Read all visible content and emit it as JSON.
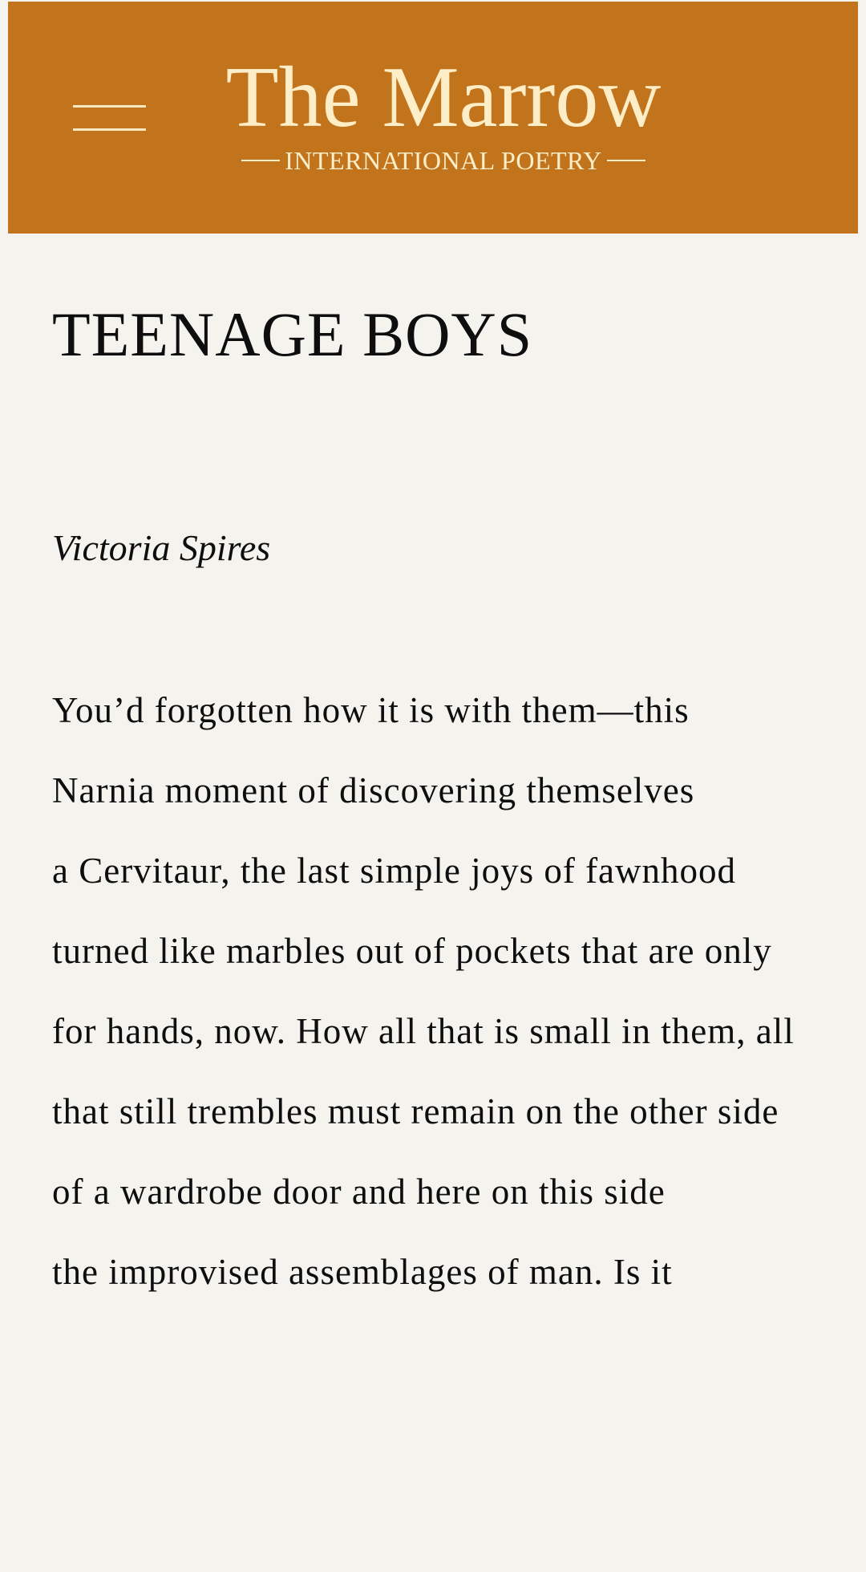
{
  "header": {
    "menu_icon": "hamburger-menu-icon",
    "site_title": "The Marrow",
    "site_subtitle": "INTERNATIONAL POETRY",
    "colors": {
      "background": "#c2741d",
      "text": "#fdeec8"
    }
  },
  "article": {
    "title": "TEENAGE BOYS",
    "author": "Victoria Spires",
    "lines": [
      "You’d forgotten how it is with them—this",
      "Narnia moment of discovering themselves",
      "a Cervitaur, the last simple joys of fawnhood",
      "turned like marbles out of pockets that are only",
      "for hands, now. How all that is small in them, all",
      "that still trembles must remain on the other side",
      "of a wardrobe door and here on this side",
      "the improvised assemblages of man. Is it"
    ]
  },
  "page": {
    "background": "#f4f3ee",
    "text_color": "#0e0e0e"
  }
}
